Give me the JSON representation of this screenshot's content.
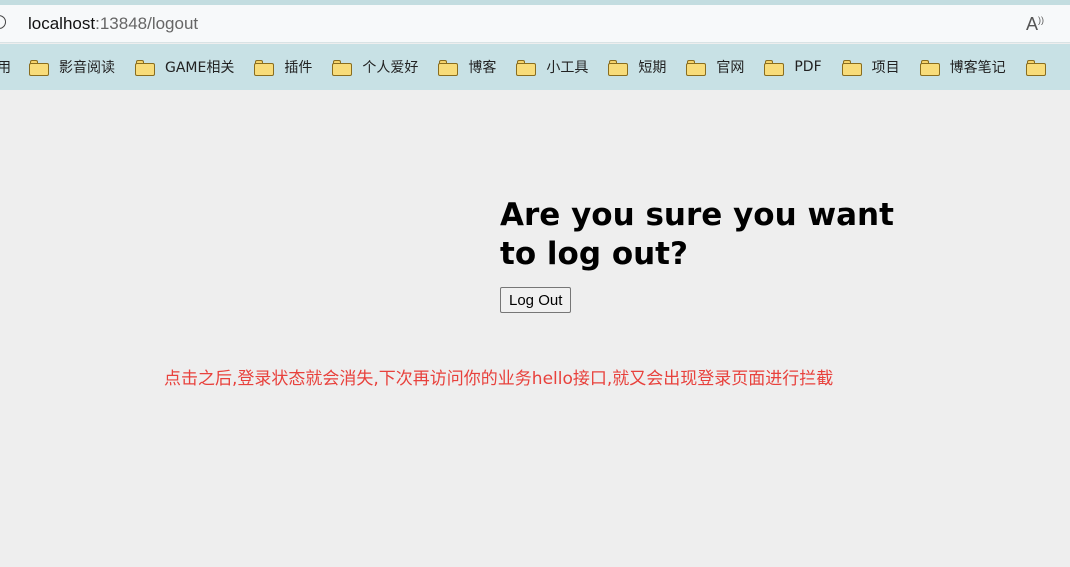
{
  "browser": {
    "url_host": "localhost",
    "url_rest": ":13848/logout",
    "read_aloud_icon": "read-aloud-icon"
  },
  "bookmarks": {
    "first_partial": "用",
    "items": [
      "影音阅读",
      "GAME相关",
      "插件",
      "个人爱好",
      "博客",
      "小工具",
      "短期",
      "官网",
      "PDF",
      "项目",
      "博客笔记"
    ],
    "icon": "folder-icon"
  },
  "page": {
    "heading": "Are you sure you want to log out?",
    "button_label": "Log Out",
    "note": "点击之后,登录状态就会消失,下次再访问你的业务hello接口,就又会出现登录页面进行拦截",
    "note_color": "#e8413c"
  }
}
